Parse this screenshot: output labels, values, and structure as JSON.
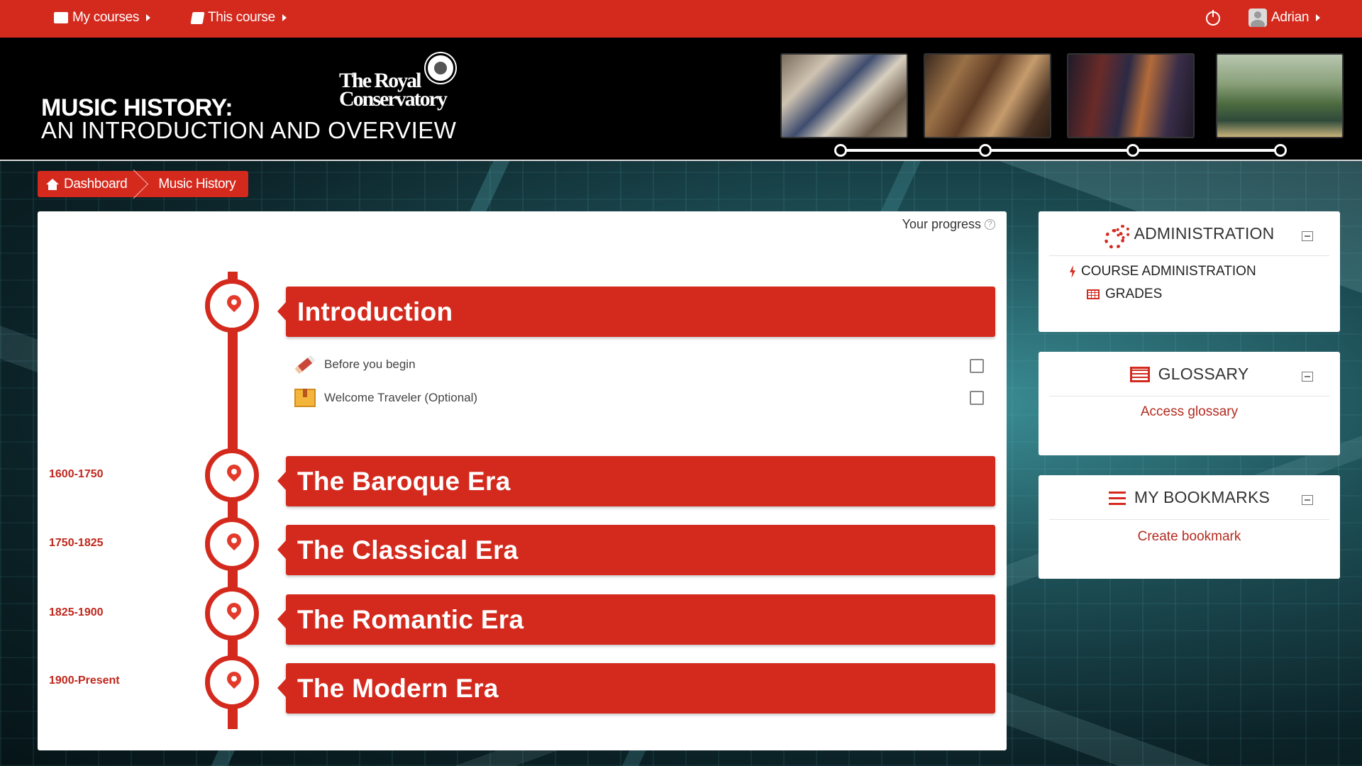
{
  "topnav": {
    "my_courses": "My courses",
    "this_course": "This course",
    "user": "Adrian"
  },
  "header": {
    "title_line1": "MUSIC HISTORY:",
    "title_line2": "AN INTRODUCTION AND OVERVIEW",
    "logo_line1": "The Royal",
    "logo_line2": "Conservatory"
  },
  "breadcrumb": {
    "dashboard": "Dashboard",
    "current": "Music History"
  },
  "main": {
    "progress_label": "Your progress",
    "sections": [
      {
        "title": "Introduction",
        "date": ""
      },
      {
        "title": "The Baroque Era",
        "date": "1600-1750"
      },
      {
        "title": "The Classical Era",
        "date": "1750-1825"
      },
      {
        "title": "The Romantic Era",
        "date": "1825-1900"
      },
      {
        "title": "The Modern Era",
        "date": "1900-Present"
      }
    ],
    "activities": [
      {
        "label": "Before you begin",
        "icon": "pencil-icon",
        "checked": false
      },
      {
        "label": "Welcome Traveler (Optional)",
        "icon": "package-icon",
        "checked": false
      }
    ]
  },
  "blocks": {
    "administration": {
      "title": "ADMINISTRATION",
      "items": [
        "COURSE ADMINISTRATION",
        "GRADES"
      ]
    },
    "glossary": {
      "title": "GLOSSARY",
      "link": "Access glossary"
    },
    "bookmarks": {
      "title": "MY BOOKMARKS",
      "link": "Create bookmark"
    }
  },
  "colors": {
    "brand_red": "#d42a1e",
    "date_red": "#c0261c",
    "link_red": "#b32b20"
  }
}
